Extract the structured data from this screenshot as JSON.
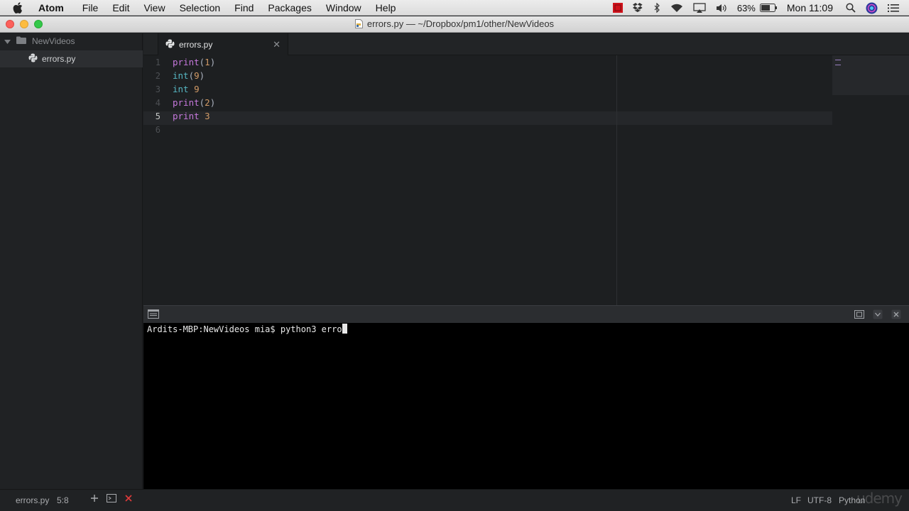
{
  "menubar": {
    "app_name": "Atom",
    "items": [
      "File",
      "Edit",
      "View",
      "Selection",
      "Find",
      "Packages",
      "Window",
      "Help"
    ],
    "battery_percent": "63%",
    "clock": "Mon 11:09",
    "status_icons": [
      "red-square-icon",
      "dropbox-icon",
      "bluetooth-icon",
      "wifi-icon",
      "airplay-icon",
      "volume-icon",
      "battery-icon",
      "search-icon",
      "siri-icon",
      "list-icon"
    ]
  },
  "window": {
    "title": "errors.py — ~/Dropbox/pm1/other/NewVideos"
  },
  "tree": {
    "root_folder": "NewVideos",
    "files": [
      "errors.py"
    ]
  },
  "tabs": [
    {
      "label": "errors.py",
      "active": true
    }
  ],
  "editor": {
    "active_line": 5,
    "lines": [
      {
        "num": "1",
        "tokens": [
          {
            "t": "print",
            "c": "fn"
          },
          {
            "t": "(",
            "c": "paren"
          },
          {
            "t": "1",
            "c": "num"
          },
          {
            "t": ")",
            "c": "paren"
          }
        ]
      },
      {
        "num": "2",
        "tokens": [
          {
            "t": "int",
            "c": "builtin"
          },
          {
            "t": "(",
            "c": "paren"
          },
          {
            "t": "9",
            "c": "num"
          },
          {
            "t": ")",
            "c": "paren"
          }
        ]
      },
      {
        "num": "3",
        "tokens": [
          {
            "t": "int",
            "c": "builtin"
          },
          {
            "t": " ",
            "c": "paren"
          },
          {
            "t": "9",
            "c": "num"
          }
        ]
      },
      {
        "num": "4",
        "tokens": [
          {
            "t": "print",
            "c": "fn"
          },
          {
            "t": "(",
            "c": "paren"
          },
          {
            "t": "2",
            "c": "num"
          },
          {
            "t": ")",
            "c": "paren"
          }
        ]
      },
      {
        "num": "5",
        "tokens": [
          {
            "t": "print",
            "c": "fn"
          },
          {
            "t": " ",
            "c": "paren"
          },
          {
            "t": "3",
            "c": "num"
          }
        ]
      },
      {
        "num": "6",
        "tokens": []
      }
    ]
  },
  "terminal": {
    "prompt": "Ardits-MBP:NewVideos mia$ ",
    "input": "python3 erro"
  },
  "statusbar": {
    "file": "errors.py",
    "cursor_pos": "5:8",
    "line_ending": "LF",
    "encoding": "UTF-8",
    "grammar": "Python",
    "watermark": "udemy"
  },
  "colors": {
    "keyword_print": "#c678dd",
    "builtin_int": "#56b6c2",
    "number": "#d19a66",
    "editor_bg": "#1d1f21",
    "terminal_bg": "#000000"
  }
}
